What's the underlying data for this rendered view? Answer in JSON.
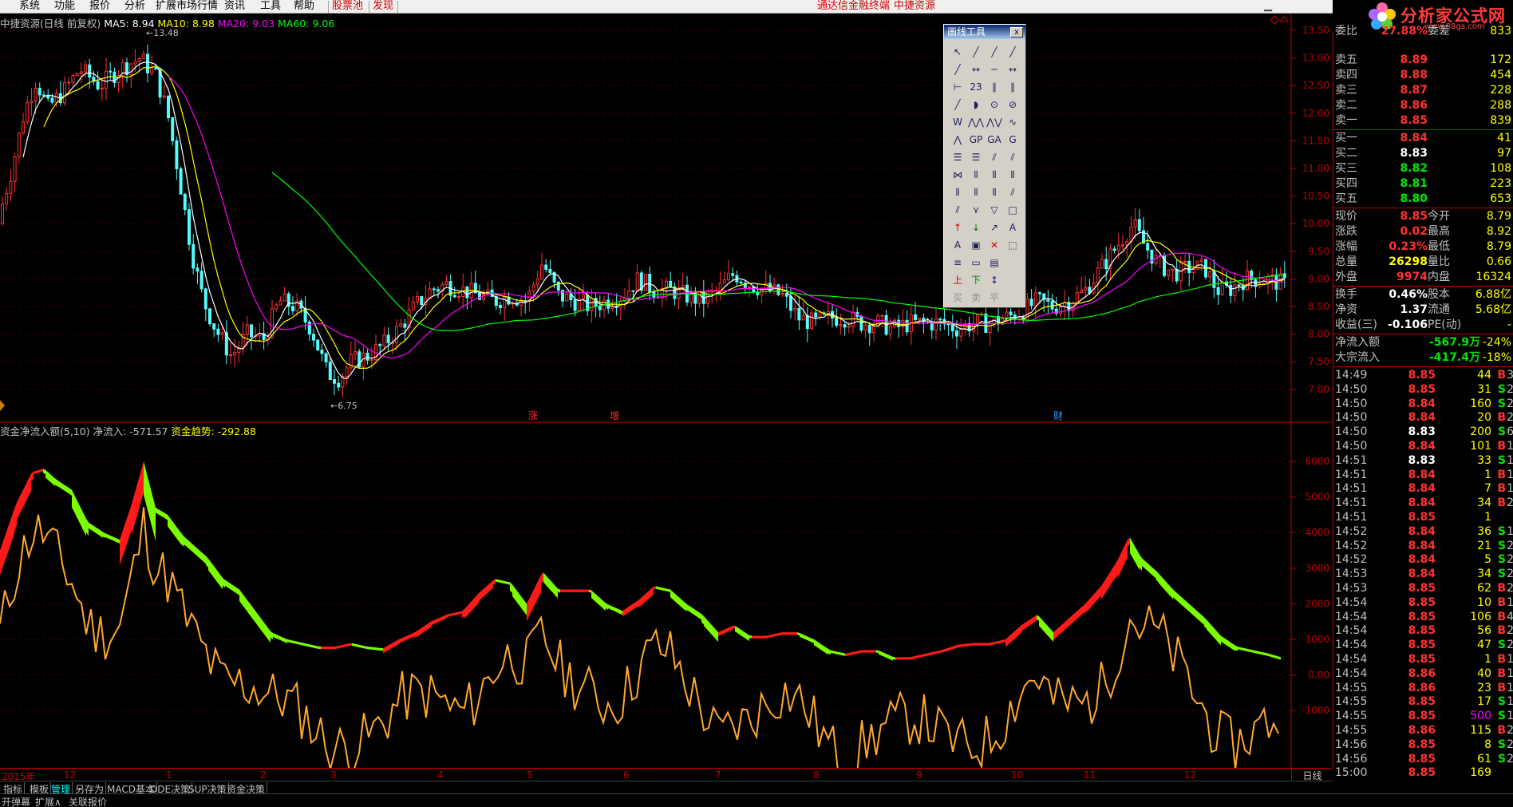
{
  "menu": {
    "items": [
      "系统",
      "功能",
      "报价",
      "分析",
      "扩展市场行情",
      "资讯",
      "工具",
      "帮助"
    ],
    "red_items": [
      "股票池",
      "发现"
    ],
    "center_items": [
      "通达信金融终端",
      "中捷资源"
    ]
  },
  "logo": {
    "text": "分析家公式网",
    "url": "www.88gs.com"
  },
  "price_panel": {
    "title": "中捷资源(日线 前复权)",
    "ma5_label": "MA5: 8.94",
    "ma10_label": "MA10: 8.98",
    "ma20_label": "MA20: 9.03",
    "ma60_label": "MA60: 9.06",
    "high_mark": "13.48",
    "low_mark": "6.75",
    "markers": [
      "涨",
      "增",
      "财"
    ],
    "y_ticks": [
      "13.50",
      "13.00",
      "12.50",
      "12.00",
      "11.50",
      "11.00",
      "10.50",
      "10.00",
      "9.50",
      "9.00",
      "8.50",
      "8.00",
      "7.50",
      "7.00"
    ],
    "colors": {
      "ma5": "#ffffff",
      "ma10": "#ffff00",
      "ma20": "#ff00ff",
      "ma60": "#00ff00",
      "up": "#ff3232",
      "down": "#54fcfc"
    }
  },
  "flow_panel": {
    "title": "资金净流入额(5,10)",
    "net_label": "净流入: -571.57",
    "trend_label": "资金趋势: -292.88",
    "y_ticks": [
      "6000",
      "5000",
      "4000",
      "3000",
      "2000",
      "1000",
      "0.00",
      "-1000"
    ]
  },
  "date_axis": {
    "labels": [
      "2015年",
      "12",
      "1",
      "2",
      "3",
      "4",
      "5",
      "6",
      "7",
      "8",
      "9",
      "10",
      "11",
      "12"
    ],
    "period": "日线"
  },
  "tabs": [
    "指标",
    "模板",
    "管理",
    "另存为",
    "MACD基本",
    "DDE决策",
    "SUP决策",
    "资金决策"
  ],
  "status": {
    "left": [
      "开弹幕",
      "扩展∧",
      "关联报价"
    ]
  },
  "toolbox": {
    "title": "画线工具",
    "close": "x",
    "tools": [
      "↖",
      "╱",
      "╱",
      "╱",
      "╱",
      "↔",
      "─",
      "↔",
      "⊢",
      "23",
      "∥",
      "∥",
      "╱",
      "◗",
      "⊙",
      "⊘",
      "W",
      "⋀⋀",
      "⋀⋁",
      "∿",
      "⋀",
      "GP",
      "GA",
      "G",
      "☰",
      "☰",
      "⫽",
      "⫽",
      "⋈",
      "⦀",
      "⦀",
      "⦀",
      "⦀",
      "⦀",
      "⦀",
      "⫽",
      "⫽",
      "⋎",
      "▽",
      "□",
      "↑",
      "↓",
      "↗",
      "A",
      "A",
      "▣",
      "✕",
      "⬚",
      "≡",
      "▭",
      "▤",
      "",
      "上",
      "下",
      "↕",
      "",
      "买",
      "卖",
      "平",
      ""
    ]
  },
  "quote": {
    "header": {
      "label": "委比",
      "value": "27.88%",
      "label2": "委差",
      "value2": "833"
    },
    "sells": [
      {
        "label": "卖五",
        "price": "8.89",
        "vol": "172"
      },
      {
        "label": "卖四",
        "price": "8.88",
        "vol": "454"
      },
      {
        "label": "卖三",
        "price": "8.87",
        "vol": "228"
      },
      {
        "label": "卖二",
        "price": "8.86",
        "vol": "288"
      },
      {
        "label": "卖一",
        "price": "8.85",
        "vol": "839"
      }
    ],
    "buys": [
      {
        "label": "买一",
        "price": "8.84",
        "vol": "41"
      },
      {
        "label": "买二",
        "price": "8.83",
        "vol": "97"
      },
      {
        "label": "买三",
        "price": "8.82",
        "vol": "108"
      },
      {
        "label": "买四",
        "price": "8.81",
        "vol": "223"
      },
      {
        "label": "买五",
        "price": "8.80",
        "vol": "653"
      }
    ],
    "stats": [
      {
        "l": "现价",
        "v": "8.85",
        "vc": "red",
        "l2": "今开",
        "v2": "8.79",
        "v2c": "green"
      },
      {
        "l": "涨跌",
        "v": "0.02",
        "vc": "red",
        "l2": "最高",
        "v2": "8.92",
        "v2c": "red"
      },
      {
        "l": "涨幅",
        "v": "0.23%",
        "vc": "red",
        "l2": "最低",
        "v2": "8.79",
        "v2c": "green"
      },
      {
        "l": "总量",
        "v": "26298",
        "vc": "yellow",
        "l2": "量比",
        "v2": "0.66",
        "v2c": "yellow"
      },
      {
        "l": "外盘",
        "v": "9974",
        "vc": "red",
        "l2": "内盘",
        "v2": "16324",
        "v2c": "green"
      }
    ],
    "stats2": [
      {
        "l": "换手",
        "v": "0.46%",
        "vc": "white",
        "l2": "股本",
        "v2": "6.88亿",
        "v2c": "white"
      },
      {
        "l": "净资",
        "v": "1.37",
        "vc": "white",
        "l2": "流通",
        "v2": "5.68亿",
        "v2c": "white"
      },
      {
        "l": "收益(三)",
        "v": "-0.106",
        "vc": "white",
        "l2": "PE(动)",
        "v2": "-",
        "v2c": "white"
      }
    ],
    "flows": [
      {
        "l": "净流入额",
        "v": "-567.9万",
        "v2": "-24%"
      },
      {
        "l": "大宗流入",
        "v": "-417.4万",
        "v2": "-18%"
      }
    ],
    "ticks": [
      [
        "14:49",
        "8.85",
        "red",
        "44",
        "B",
        "3"
      ],
      [
        "14:50",
        "8.85",
        "red",
        "31",
        "S",
        "2"
      ],
      [
        "14:50",
        "8.84",
        "red",
        "160",
        "S",
        "2"
      ],
      [
        "14:50",
        "8.84",
        "red",
        "20",
        "B",
        "2"
      ],
      [
        "14:50",
        "8.83",
        "white",
        "200",
        "S",
        "6"
      ],
      [
        "14:50",
        "8.84",
        "red",
        "101",
        "B",
        "1"
      ],
      [
        "14:51",
        "8.83",
        "white",
        "33",
        "S",
        "1"
      ],
      [
        "14:51",
        "8.84",
        "red",
        "1",
        "B",
        "1"
      ],
      [
        "14:51",
        "8.84",
        "red",
        "7",
        "B",
        "1"
      ],
      [
        "14:51",
        "8.84",
        "red",
        "34",
        "B",
        "2"
      ],
      [
        "14:51",
        "8.85",
        "red",
        "1",
        "",
        ""
      ],
      [
        "14:52",
        "8.84",
        "red",
        "36",
        "S",
        "1"
      ],
      [
        "14:52",
        "8.84",
        "red",
        "21",
        "S",
        "2"
      ],
      [
        "14:52",
        "8.84",
        "red",
        "5",
        "S",
        "2"
      ],
      [
        "14:53",
        "8.84",
        "red",
        "34",
        "S",
        "2"
      ],
      [
        "14:53",
        "8.85",
        "red",
        "62",
        "B",
        "2"
      ],
      [
        "14:54",
        "8.85",
        "red",
        "10",
        "B",
        "1"
      ],
      [
        "14:54",
        "8.85",
        "red",
        "106",
        "B",
        "4"
      ],
      [
        "14:54",
        "8.85",
        "red",
        "56",
        "B",
        "2"
      ],
      [
        "14:54",
        "8.85",
        "red",
        "47",
        "S",
        "2"
      ],
      [
        "14:54",
        "8.85",
        "red",
        "1",
        "B",
        "1"
      ],
      [
        "14:54",
        "8.86",
        "red",
        "40",
        "B",
        "1"
      ],
      [
        "14:55",
        "8.86",
        "red",
        "23",
        "B",
        "1"
      ],
      [
        "14:55",
        "8.85",
        "red",
        "17",
        "S",
        "1"
      ],
      [
        "14:55",
        "8.85",
        "red",
        "500",
        "S",
        "1"
      ],
      [
        "14:55",
        "8.86",
        "red",
        "115",
        "B",
        "2"
      ],
      [
        "14:56",
        "8.85",
        "red",
        "8",
        "S",
        "2"
      ],
      [
        "14:56",
        "8.85",
        "red",
        "61",
        "S",
        "2"
      ],
      [
        "15:00",
        "8.85",
        "red",
        "169",
        "",
        ""
      ]
    ]
  }
}
